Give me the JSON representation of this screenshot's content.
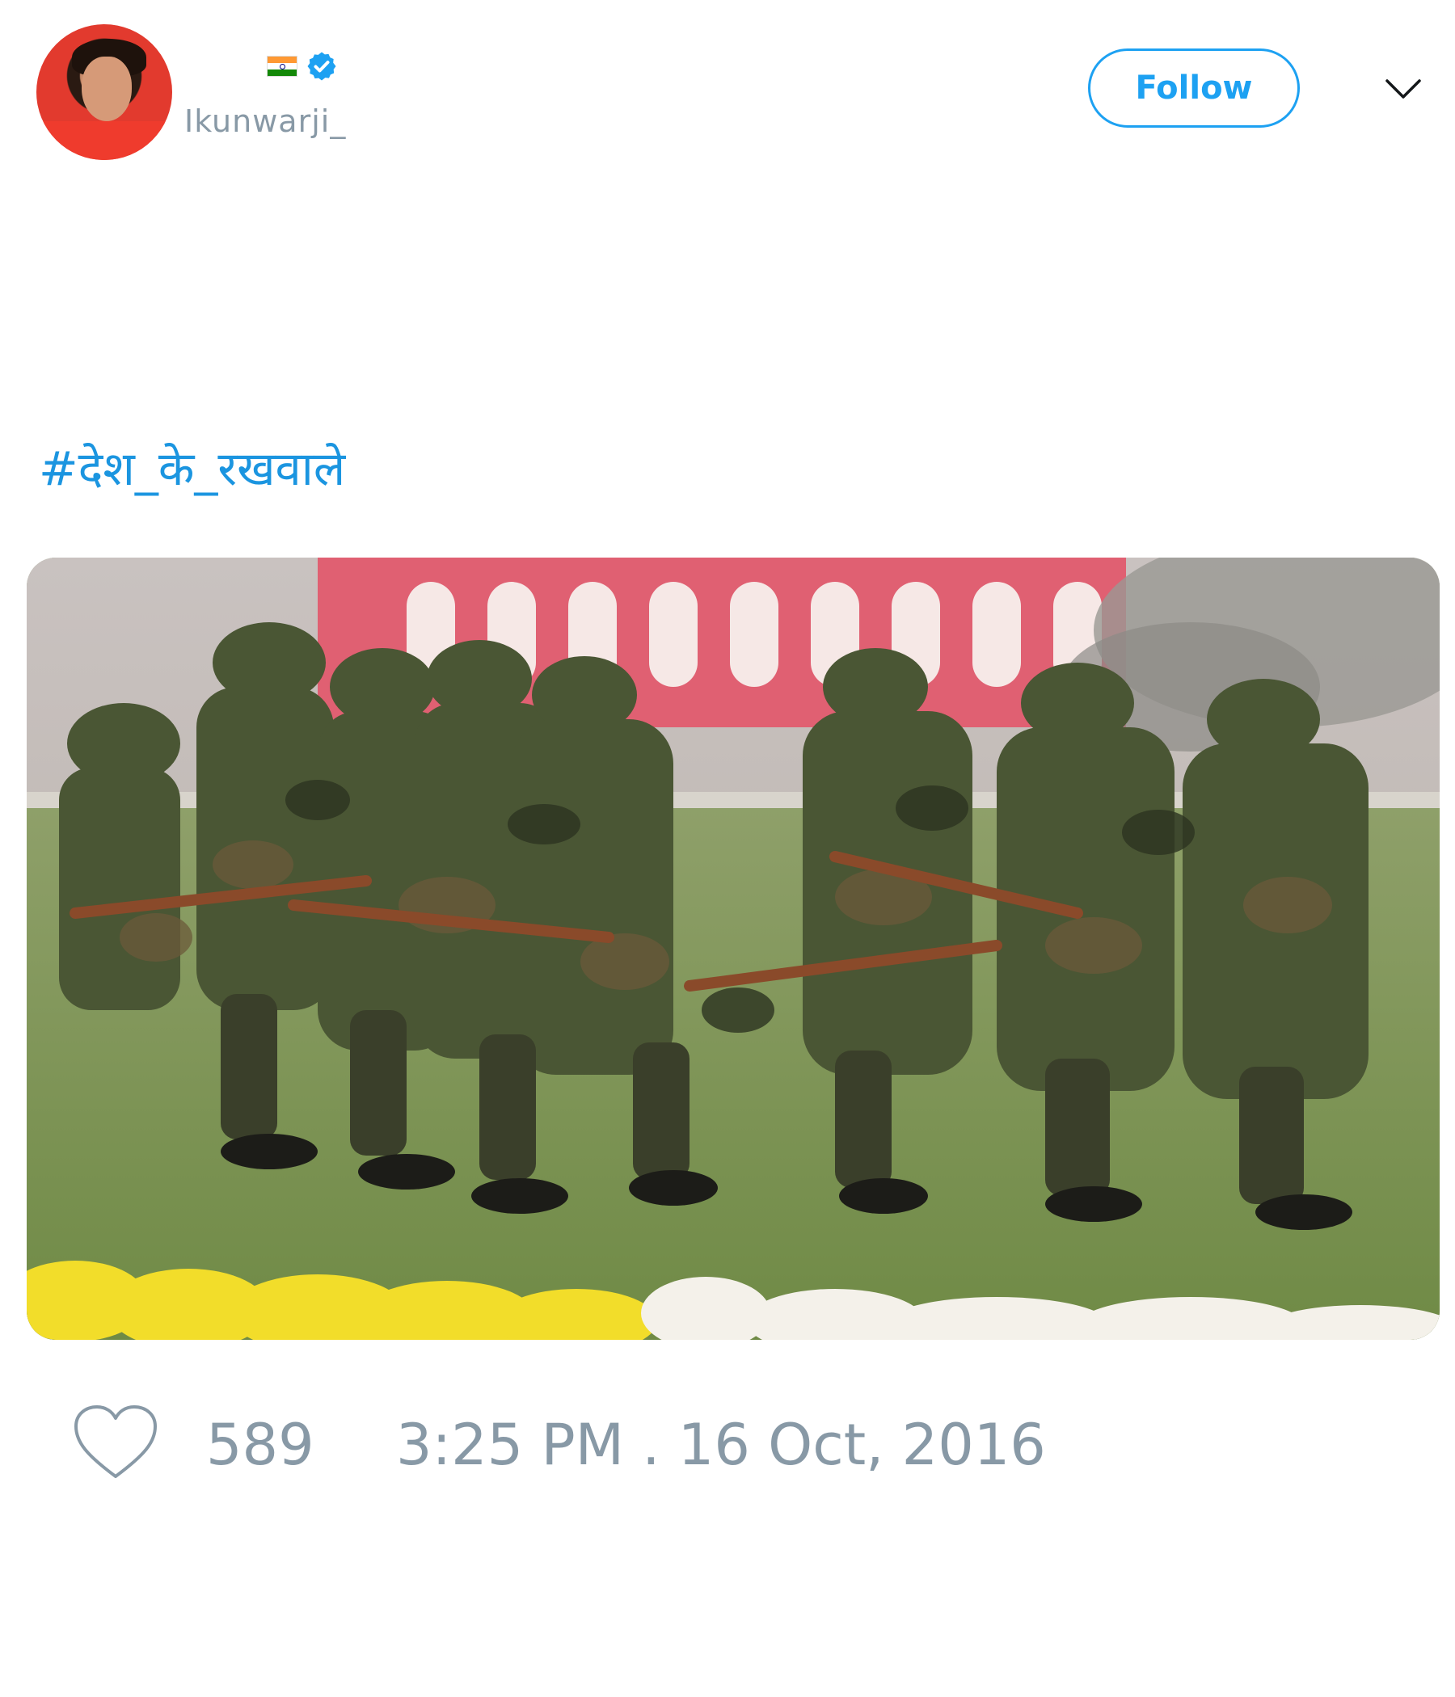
{
  "author": {
    "handle": "Ikunwarji_",
    "flag_icon": "india-flag-icon",
    "verified_icon": "verified-badge-icon"
  },
  "header": {
    "follow_label": "Follow",
    "menu_icon": "chevron-down-icon"
  },
  "tweet": {
    "text": "#देश_के_रखवाले",
    "photo_icon": "soldiers-marching-photo"
  },
  "footer": {
    "like_count": "589",
    "timestamp": "3:25 PM . 16 Oct, 2016",
    "heart_icon": "heart-icon"
  },
  "colors": {
    "accent": "#1da1f2",
    "link": "#1b95e0",
    "muted": "#8899a6"
  }
}
